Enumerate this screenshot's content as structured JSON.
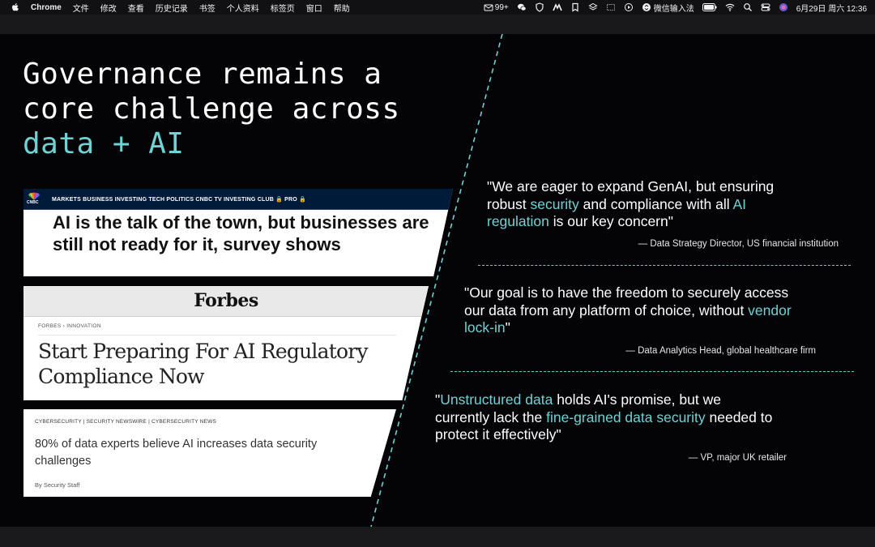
{
  "menubar": {
    "app": "Chrome",
    "menus": [
      "文件",
      "修改",
      "查看",
      "历史记录",
      "书签",
      "个人资料",
      "标签页",
      "窗口",
      "帮助"
    ],
    "status_badge": "99+",
    "input_method": "微信输入法",
    "datetime": "6月29日 周六  12:36"
  },
  "slide": {
    "title_line1": "Governance remains a",
    "title_line2": "core challenge across",
    "title_accent": "data + AI",
    "accent_color": "#6fd2d4"
  },
  "clippings": {
    "cnbc": {
      "logo": "CNBC",
      "nav": "MARKETS    BUSINESS    INVESTING    TECH    POLITICS    CNBC TV    INVESTING CLUB 🔒    PRO 🔒",
      "headline": "AI is the talk of the town, but businesses are still not ready for it, survey shows"
    },
    "forbes": {
      "logo": "Forbes",
      "breadcrumb": "FORBES  ›  INNOVATION",
      "headline": "Start Preparing For AI Regulatory Compliance Now"
    },
    "cyber": {
      "tags": "CYBERSECURITY  |  SECURITY NEWSWIRE  |  CYBERSECURITY NEWS",
      "headline": "80% of data experts believe AI increases data security challenges",
      "byline": "By Security Staff"
    }
  },
  "quotes": [
    {
      "open": "\"We are eager to expand GenAI, but ensuring robust ",
      "hl1": "security",
      "mid": " and compliance with all ",
      "hl2": "AI regulation",
      "close": " is our key concern\"",
      "attribution": "— Data Strategy Director, US financial institution"
    },
    {
      "open": "\"Our goal is to have the freedom to securely access our data from any platform of choice, without ",
      "hl1": "vendor lock-in",
      "close": "\"",
      "attribution": "— Data Analytics Head, global healthcare firm"
    },
    {
      "open": "\"",
      "hl1": "Unstructured data",
      "mid": " holds AI's promise, but we currently lack the ",
      "hl2": "fine-grained data security",
      "close": " needed to protect it effectively\"",
      "attribution": "— VP, major UK retailer"
    }
  ]
}
